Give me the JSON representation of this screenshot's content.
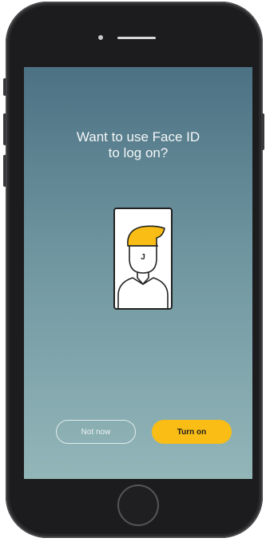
{
  "screen": {
    "title": "Want to use Face ID\nto log on?",
    "avatar_initial": "J"
  },
  "buttons": {
    "not_now_label": "Not now",
    "turn_on_label": "Turn on"
  },
  "colors": {
    "accent": "#f9bd16",
    "background_top": "#4c7183",
    "background_bottom": "#92b6b8"
  },
  "icons": {
    "face_id": "face-id-avatar-icon",
    "home": "home-button"
  }
}
